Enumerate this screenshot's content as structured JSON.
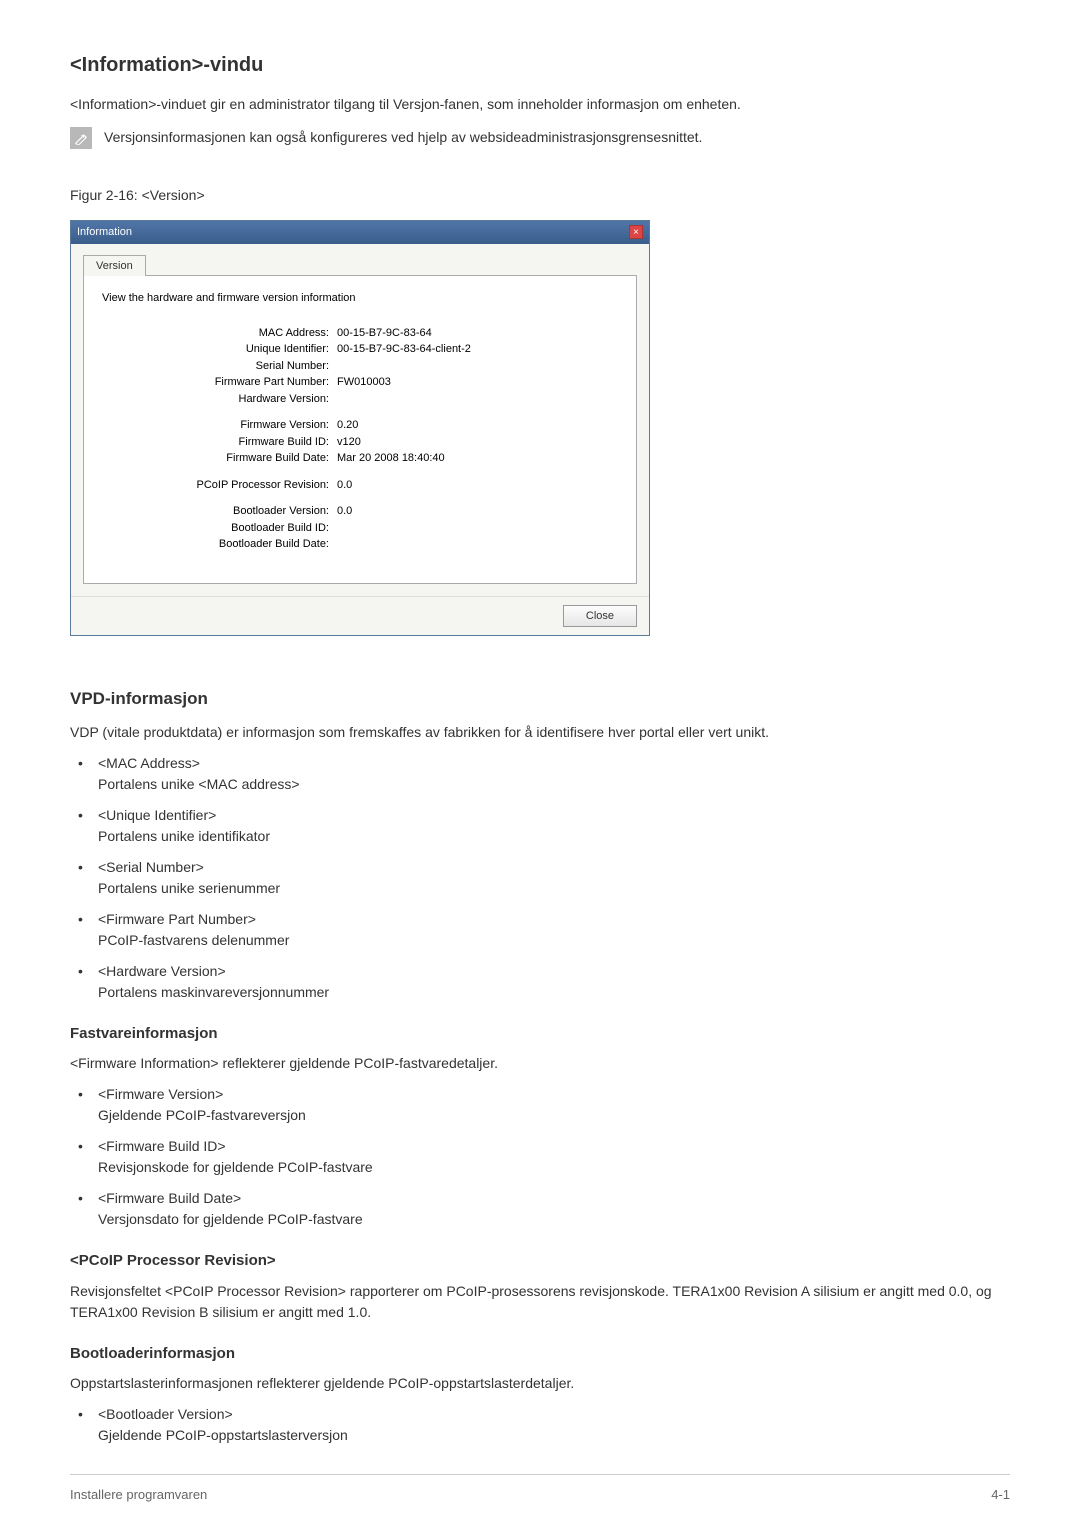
{
  "page_title": "<Information>-vindu",
  "intro": "<Information>-vinduet gir en administrator tilgang til Versjon-fanen, som inneholder informasjon om enheten.",
  "note": "Versjonsinformasjonen kan også konfigureres ved hjelp av websideadministrasjonsgrensesnittet.",
  "figure_caption": "Figur 2-16: <Version>",
  "dialog": {
    "title": "Information",
    "tab_label": "Version",
    "panel_heading": "View the hardware and firmware version information",
    "close_button": "Close",
    "groups": [
      [
        {
          "label": "MAC Address:",
          "value": "00-15-B7-9C-83-64"
        },
        {
          "label": "Unique Identifier:",
          "value": "00-15-B7-9C-83-64-client-2"
        },
        {
          "label": "Serial Number:",
          "value": ""
        },
        {
          "label": "Firmware Part Number:",
          "value": "FW010003"
        },
        {
          "label": "Hardware Version:",
          "value": ""
        }
      ],
      [
        {
          "label": "Firmware Version:",
          "value": "0.20"
        },
        {
          "label": "Firmware Build ID:",
          "value": "v120"
        },
        {
          "label": "Firmware Build Date:",
          "value": "Mar 20 2008 18:40:40"
        }
      ],
      [
        {
          "label": "PCoIP Processor Revision:",
          "value": "0.0"
        }
      ],
      [
        {
          "label": "Bootloader Version:",
          "value": "0.0"
        },
        {
          "label": "Bootloader Build ID:",
          "value": ""
        },
        {
          "label": "Bootloader Build Date:",
          "value": ""
        }
      ]
    ]
  },
  "sections": {
    "vpd": {
      "heading": "VPD-informasjon",
      "desc": "VDP (vitale produktdata) er informasjon som fremskaffes av fabrikken for å identifisere hver portal eller vert unikt.",
      "items": [
        {
          "term": "<MAC Address>",
          "def": "Portalens unike <MAC address>"
        },
        {
          "term": "<Unique Identifier>",
          "def": "Portalens unike identifikator"
        },
        {
          "term": "<Serial Number>",
          "def": "Portalens unike serienummer"
        },
        {
          "term": "<Firmware Part Number>",
          "def": "PCoIP-fastvarens delenummer"
        },
        {
          "term": "<Hardware Version>",
          "def": "Portalens maskinvareversjonnummer"
        }
      ]
    },
    "fw": {
      "heading": "Fastvareinformasjon",
      "desc": "<Firmware Information> reflekterer gjeldende PCoIP-fastvaredetaljer.",
      "items": [
        {
          "term": "<Firmware Version>",
          "def": "Gjeldende PCoIP-fastvareversjon"
        },
        {
          "term": "<Firmware Build ID>",
          "def": "Revisjonskode for gjeldende PCoIP-fastvare"
        },
        {
          "term": "<Firmware Build Date>",
          "def": "Versjonsdato for gjeldende PCoIP-fastvare"
        }
      ]
    },
    "proc": {
      "heading": "<PCoIP Processor Revision>",
      "desc": "Revisjonsfeltet <PCoIP Processor Revision> rapporterer om PCoIP-prosessorens revisjonskode. TERA1x00 Revision A silisium er angitt med 0.0, og TERA1x00 Revision B silisium er angitt med 1.0."
    },
    "boot": {
      "heading": "Bootloaderinformasjon",
      "desc": "Oppstartslasterinformasjonen reflekterer gjeldende PCoIP-oppstartslasterdetaljer.",
      "items": [
        {
          "term": "<Bootloader Version>",
          "def": "Gjeldende PCoIP-oppstartslasterversjon"
        }
      ]
    }
  },
  "footer": {
    "left": "Installere programvaren",
    "right": "4-1"
  }
}
